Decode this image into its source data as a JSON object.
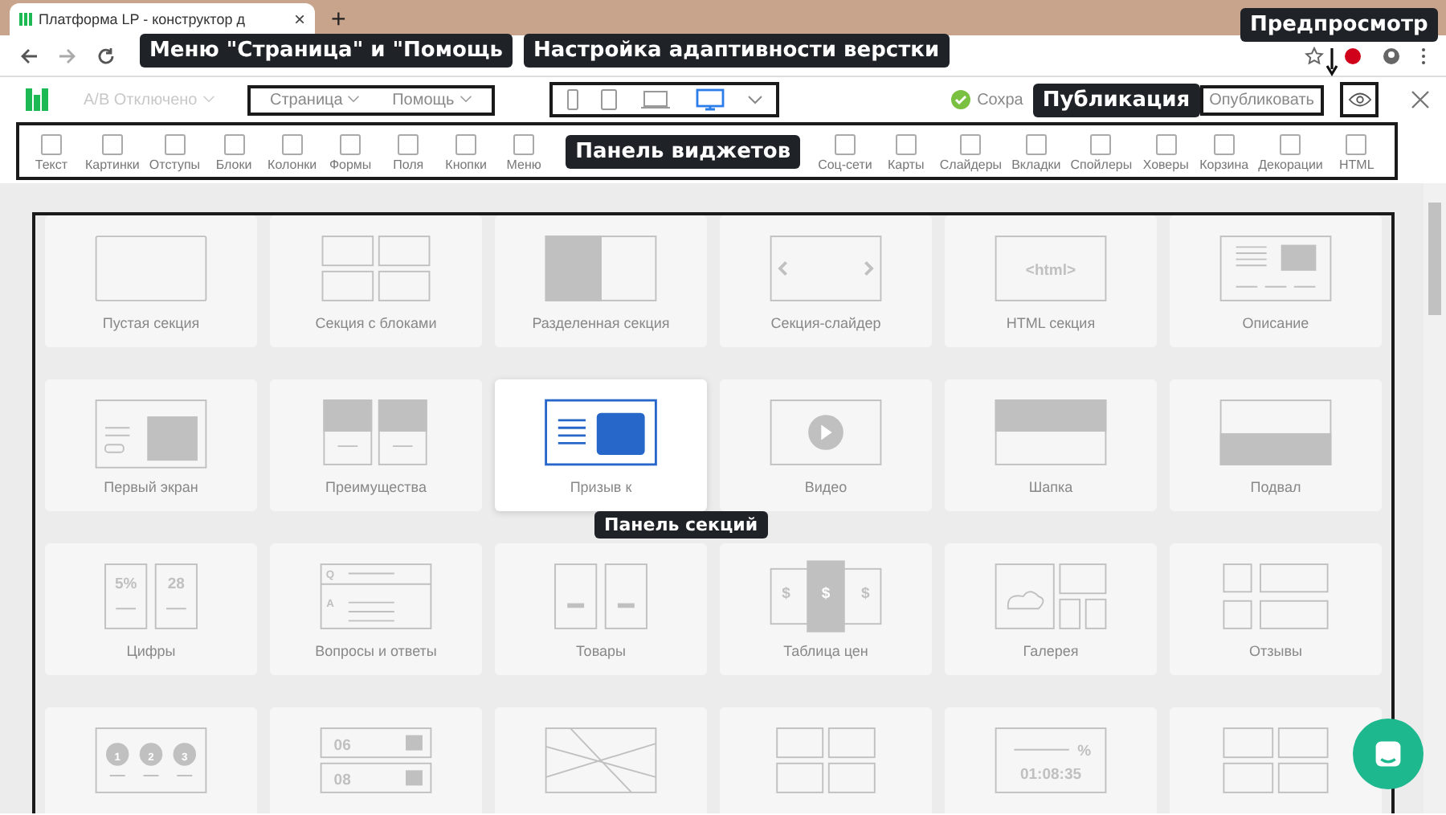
{
  "browser": {
    "tab_title": "Платформа LP - конструктор д",
    "tab_close": "×",
    "new_tab": "+"
  },
  "annotations": [
    {
      "kind": "page_menu",
      "text": "Меню \"Страница\" и \"Помощь"
    },
    {
      "kind": "devices",
      "text": "Настройка адаптивности верстки"
    },
    {
      "kind": "preview",
      "text": "Предпросмотр"
    },
    {
      "kind": "publish",
      "text": "Публикация"
    },
    {
      "kind": "widgets",
      "text": "Панель виджетов"
    },
    {
      "kind": "sections",
      "text": "Панель секций"
    }
  ],
  "header": {
    "ab_test": "A/B Отключено",
    "menus": [
      "Страница",
      "Помощь"
    ],
    "devices": [
      {
        "kind": "phone",
        "selected": false
      },
      {
        "kind": "tablet",
        "selected": false
      },
      {
        "kind": "laptop",
        "selected": false
      },
      {
        "kind": "desktop",
        "selected": true
      }
    ],
    "save_status": "Сохра",
    "publish_button": "Опубликовать"
  },
  "widgets_before": [
    "Текст",
    "Картинки",
    "Отступы",
    "Блоки",
    "Колонки",
    "Формы",
    "Поля",
    "Кнопки",
    "Меню"
  ],
  "widgets_after": [
    "Соц-сети",
    "Карты",
    "Слайдеры",
    "Вкладки",
    "Спойлеры",
    "Ховеры",
    "Корзина",
    "Декорации",
    "HTML"
  ],
  "sections": [
    {
      "kind": "blank",
      "label": "Пустая секция",
      "selected": false
    },
    {
      "kind": "blocks",
      "label": "Секция с блоками",
      "selected": false
    },
    {
      "kind": "split",
      "label": "Разделенная секция",
      "selected": false
    },
    {
      "kind": "slider",
      "label": "Секция-слайдер",
      "selected": false
    },
    {
      "kind": "html",
      "label": "HTML секция",
      "selected": false,
      "icon_text": [
        "<html>"
      ]
    },
    {
      "kind": "description",
      "label": "Описание",
      "selected": false
    },
    {
      "kind": "hero",
      "label": "Первый экран",
      "selected": false
    },
    {
      "kind": "advantages",
      "label": "Преимущества",
      "selected": false
    },
    {
      "kind": "cta",
      "label": "Призыв к",
      "selected": true
    },
    {
      "kind": "video",
      "label": "Видео",
      "selected": false
    },
    {
      "kind": "header",
      "label": "Шапка",
      "selected": false
    },
    {
      "kind": "footer",
      "label": "Подвал",
      "selected": false
    },
    {
      "kind": "numbers",
      "label": "Цифры",
      "selected": false,
      "icon_text": [
        "5%",
        "28"
      ]
    },
    {
      "kind": "faq",
      "label": "Вопросы и ответы",
      "selected": false,
      "icon_text": [
        "Q",
        "A"
      ]
    },
    {
      "kind": "products",
      "label": "Товары",
      "selected": false
    },
    {
      "kind": "pricing",
      "label": "Таблица цен",
      "selected": false,
      "icon_text": [
        "$",
        "$",
        "$"
      ]
    },
    {
      "kind": "gallery",
      "label": "Галерея",
      "selected": false
    },
    {
      "kind": "reviews",
      "label": "Отзывы",
      "selected": false
    },
    {
      "kind": "steps",
      "selected": false,
      "icon_text": [
        "1",
        "2",
        "3"
      ]
    },
    {
      "kind": "schedule",
      "selected": false,
      "icon_text": [
        "06",
        "08"
      ]
    },
    {
      "kind": "map",
      "selected": false
    },
    {
      "kind": "apps",
      "selected": false
    },
    {
      "kind": "timer",
      "selected": false,
      "icon_text": [
        "%",
        "01:08:35"
      ]
    },
    {
      "kind": "team",
      "selected": false
    }
  ]
}
